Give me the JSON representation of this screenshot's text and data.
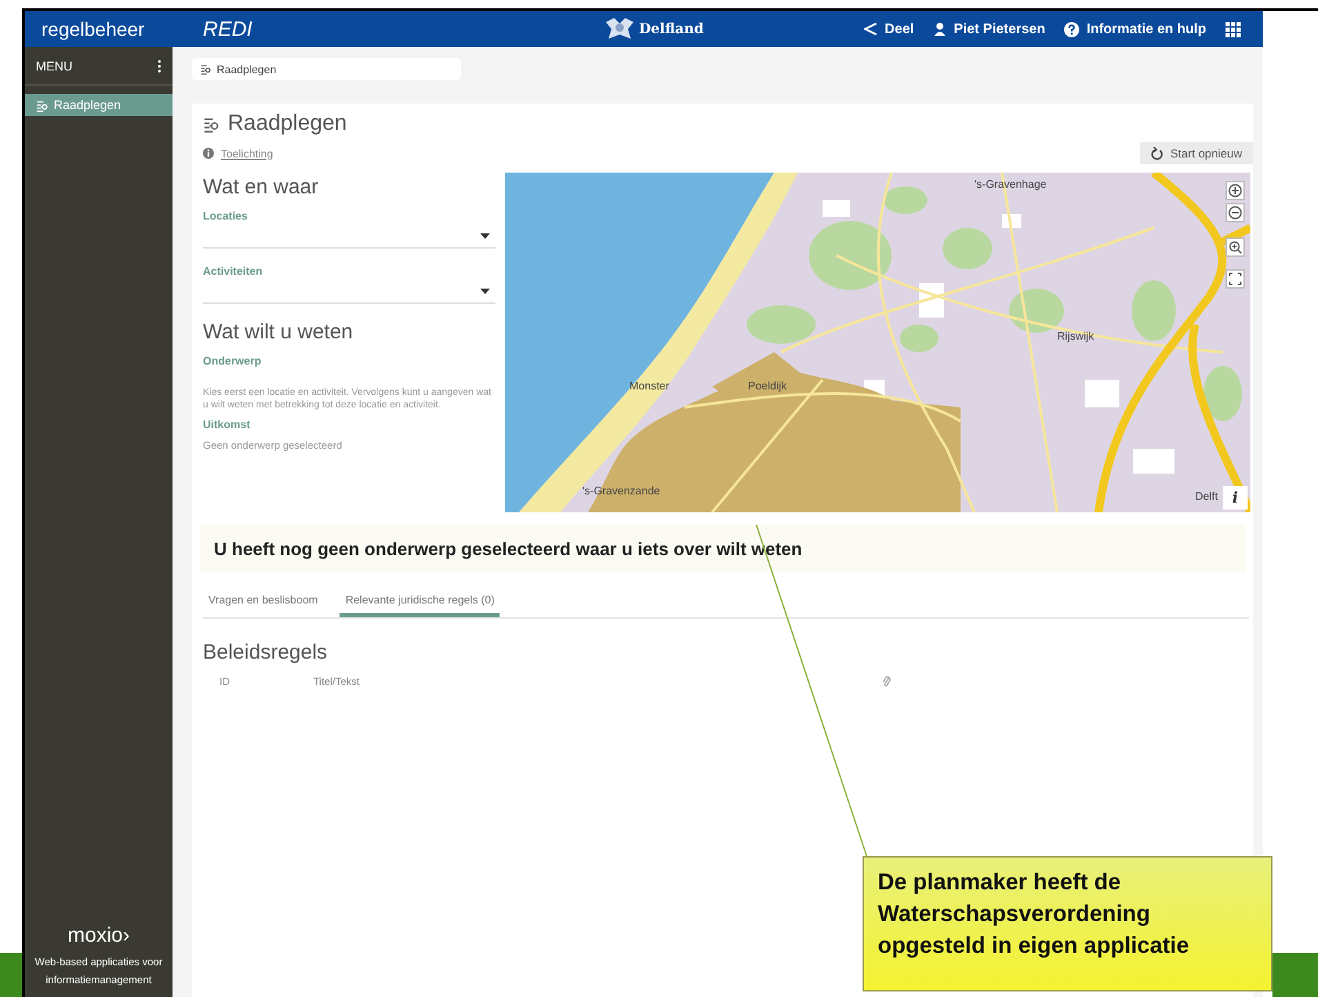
{
  "header": {
    "app_name": "regelbeheer",
    "module": "REDI",
    "logo_text": "Delfland",
    "actions": [
      {
        "label": "Deel",
        "kind": "share"
      },
      {
        "label": "Piet Pietersen",
        "kind": "user"
      },
      {
        "label": "Informatie en hulp",
        "kind": "help"
      }
    ]
  },
  "sidebar": {
    "title": "MENU",
    "items": [
      {
        "label": "Raadplegen",
        "selected": true
      }
    ],
    "brand": "moxio›",
    "tagline": "Web-based applicaties voor informatiemanagement"
  },
  "breadcrumb": "Raadplegen",
  "page": {
    "title": "Raadplegen",
    "help_link": "Toelichting",
    "restart_button": "Start opnieuw"
  },
  "form": {
    "section_1": "Wat en waar",
    "fields": [
      {
        "label": "Locaties"
      },
      {
        "label": "Activiteiten"
      }
    ],
    "section_2": "Wat wilt u weten",
    "subject_label": "Onderwerp",
    "subject_hint": "Kies eerst een locatie en activiteit. Vervolgens kunt u aangeven wat u wilt weten met betrekking tot deze locatie en activiteit.",
    "outcome_label": "Uitkomst",
    "outcome_value": "Geen onderwerp geselecteerd"
  },
  "map": {
    "places": [
      "'s-Gravenhage",
      "Rijswijk",
      "Monster",
      "Poeldijk",
      "'s-Gravenzande",
      "Delft"
    ],
    "info_button": "i"
  },
  "notice": "U heeft nog geen onderwerp geselecteerd waar u iets over wilt weten",
  "tabs": [
    {
      "label": "Vragen en beslisboom",
      "selected": false
    },
    {
      "label": "Relevante juridische regels (0)",
      "selected": true
    }
  ],
  "rules": {
    "title": "Beleidsregels",
    "columns": [
      "ID",
      "Titel/Tekst"
    ]
  },
  "callout": {
    "text": "De planmaker heeft de Waterschapsverordening opgesteld in eigen applicatie"
  }
}
